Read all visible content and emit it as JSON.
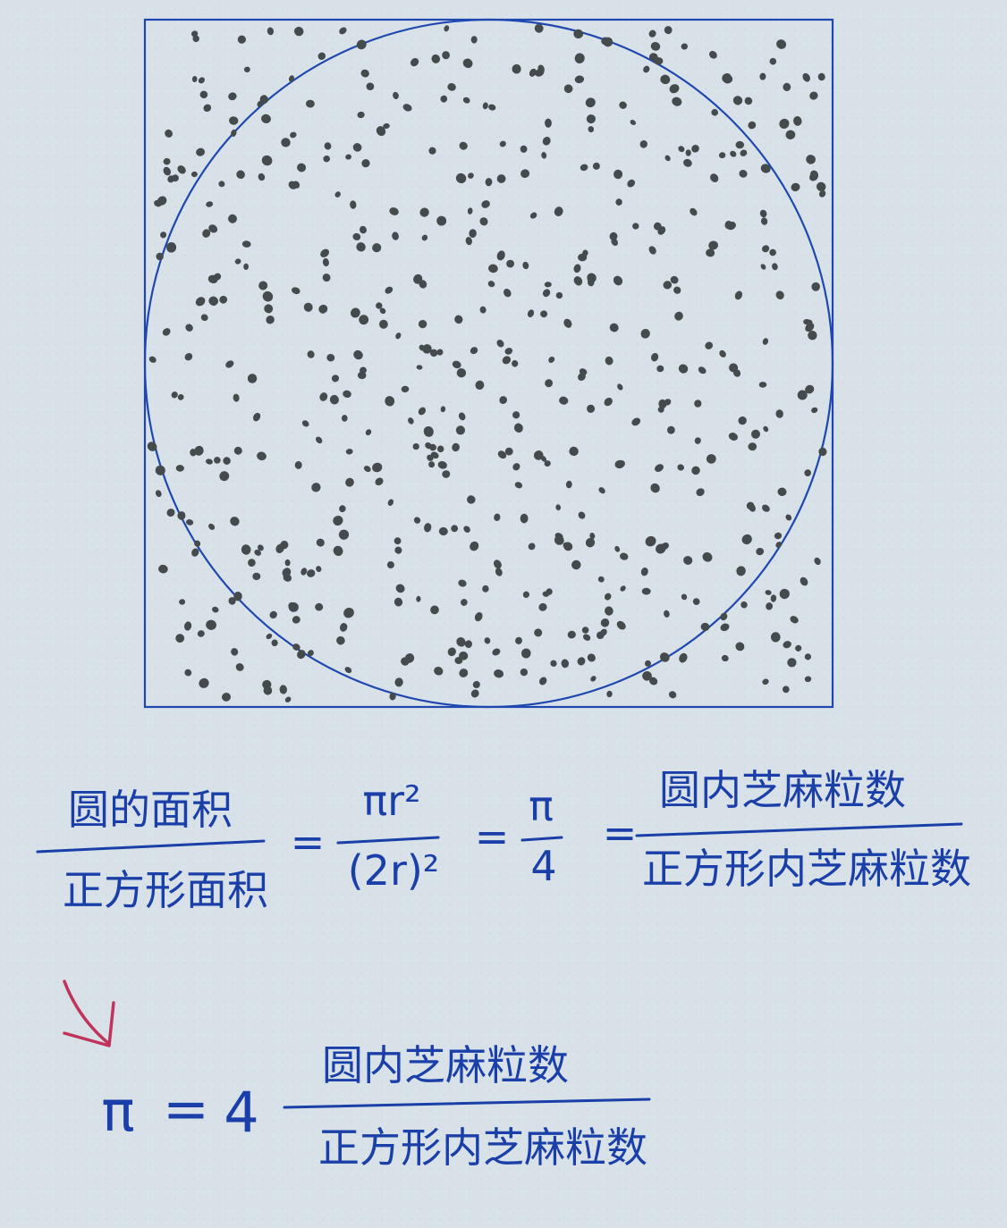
{
  "colors": {
    "ink": "#1a3fa8",
    "dot": "#454a4c",
    "arrow": "#c0335a",
    "paper": "#d7e1e7"
  },
  "figure": {
    "shape_square": "square",
    "shape_circle": "inscribed-circle",
    "random_seed": 20240511,
    "dot_count": 560
  },
  "equation1": {
    "lhs_numerator": "圆的面积",
    "lhs_denominator": "正方形面积",
    "equals_1": "=",
    "mid_numerator": "πr²",
    "mid_denominator": "(2r)²",
    "equals_2": "=",
    "pi_numerator": "π",
    "pi_denominator": "4",
    "equals_3": "=",
    "rhs_numerator": "圆内芝麻粒数",
    "rhs_denominator": "正方形内芝麻粒数"
  },
  "arrow_icon": "down-right-arrow",
  "equation2": {
    "pi": "π",
    "equals": "=",
    "factor": "4",
    "numerator": "圆内芝麻粒数",
    "denominator": "正方形内芝麻粒数"
  }
}
